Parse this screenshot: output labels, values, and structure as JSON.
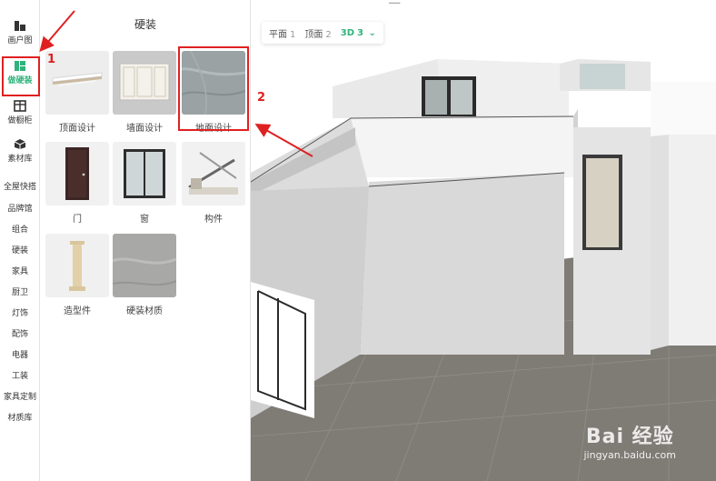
{
  "rail": {
    "items": [
      {
        "label": "画户图"
      },
      {
        "label": "做硬装"
      },
      {
        "label": "做橱柜"
      },
      {
        "label": "素材库"
      }
    ],
    "categories": [
      "全屋快搭",
      "品牌馆",
      "组合",
      "硬装",
      "家具",
      "厨卫",
      "灯饰",
      "配饰",
      "电器",
      "工装",
      "家具定制",
      "材质库"
    ]
  },
  "panel": {
    "title": "硬装",
    "tiles": [
      {
        "label": "顶面设计",
        "icon": "ceiling-design-icon"
      },
      {
        "label": "墙面设计",
        "icon": "wall-design-icon"
      },
      {
        "label": "地面设计",
        "icon": "floor-design-icon"
      },
      {
        "label": "门",
        "icon": "door-icon"
      },
      {
        "label": "窗",
        "icon": "window-icon"
      },
      {
        "label": "构件",
        "icon": "component-icon"
      },
      {
        "label": "造型件",
        "icon": "molding-icon"
      },
      {
        "label": "硬装材质",
        "icon": "material-icon"
      }
    ]
  },
  "viewport": {
    "tabs": [
      {
        "label": "平面",
        "num": "1"
      },
      {
        "label": "顶面",
        "num": "2"
      },
      {
        "label": "3D",
        "num": "3"
      }
    ],
    "chevron": "⌄"
  },
  "annotations": {
    "step1": "1",
    "step2": "2"
  },
  "watermark": {
    "logo": "Bai 经验",
    "url": "jingyan.baidu.com"
  },
  "colors": {
    "accent": "#2fb37a",
    "annotation": "#e02020"
  }
}
